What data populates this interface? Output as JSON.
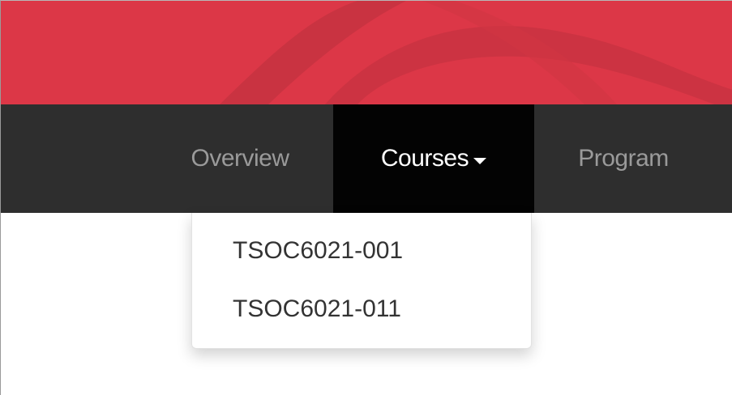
{
  "banner": {
    "color_primary": "#dc3747",
    "color_stripe": "#c73340"
  },
  "navbar": {
    "background": "#2e2e2e",
    "items": [
      {
        "label": "Overview",
        "active": false
      },
      {
        "label": "Courses",
        "active": true,
        "has_dropdown": true,
        "dropdown_icon": "caret-down-icon"
      },
      {
        "label": "Program",
        "active": false
      }
    ]
  },
  "courses_dropdown": {
    "expanded": true,
    "items": [
      {
        "label": "TSOC6021-001"
      },
      {
        "label": "TSOC6021-011"
      }
    ]
  }
}
